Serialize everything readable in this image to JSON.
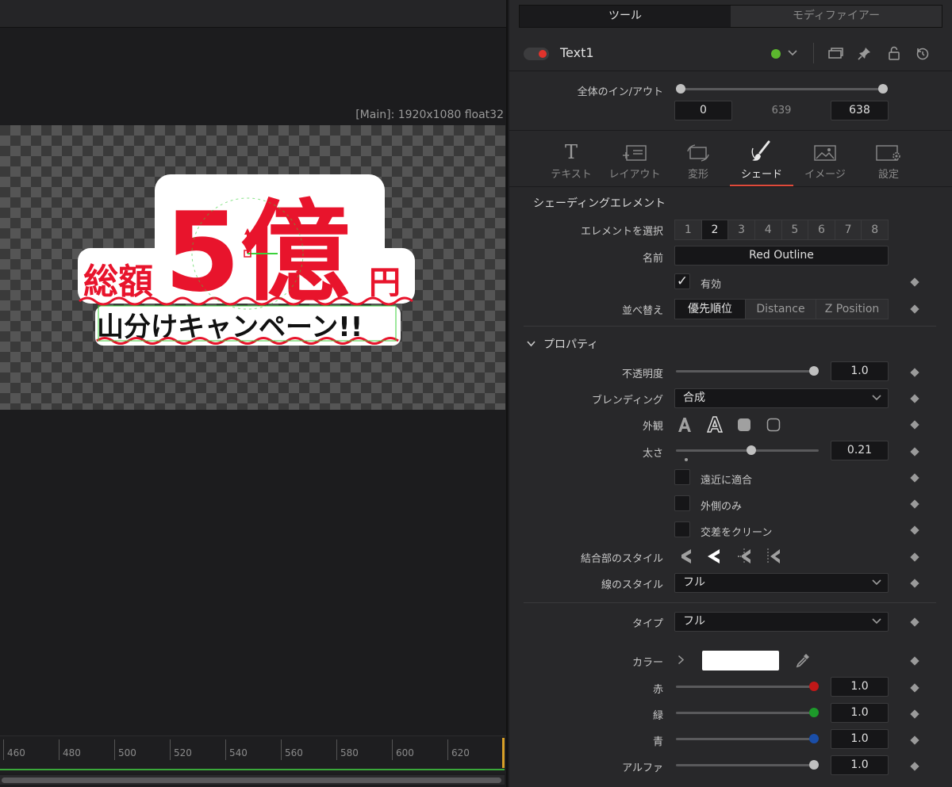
{
  "viewer": {
    "resolution_label": "[Main]: 1920x1080 float32",
    "timeline_ticks": [
      "460",
      "480",
      "500",
      "520",
      "540",
      "560",
      "580",
      "600",
      "620"
    ],
    "title_art": {
      "big_text": "5億",
      "left_text": "総額",
      "right_text": "円",
      "bottom_text": "山分けキャンペーン!!"
    }
  },
  "inspector": {
    "tabs": [
      {
        "label": "ツール",
        "active": true
      },
      {
        "label": "モディファイアー",
        "active": false
      }
    ],
    "node": {
      "name": "Text1",
      "color": "#5cb82e"
    },
    "global_inout": {
      "label": "全体のイン/アウト",
      "in": "0",
      "mid": "639",
      "out": "638"
    },
    "subtabs": [
      {
        "label": "テキスト",
        "icon": "text-t-icon"
      },
      {
        "label": "レイアウト",
        "icon": "layout-icon"
      },
      {
        "label": "変形",
        "icon": "transform-icon"
      },
      {
        "label": "シェード",
        "icon": "brush-icon",
        "active": true
      },
      {
        "label": "イメージ",
        "icon": "image-icon"
      },
      {
        "label": "設定",
        "icon": "settings-icon"
      }
    ],
    "shading": {
      "section_title": "シェーディングエレメント",
      "select_label": "エレメントを選択",
      "elements": [
        "1",
        "2",
        "3",
        "4",
        "5",
        "6",
        "7",
        "8"
      ],
      "active_element": "2",
      "name_label": "名前",
      "name_value": "Red Outline",
      "enabled_label": "有効",
      "enabled": true,
      "sort_label": "並べ替え",
      "sort_options": [
        "優先順位",
        "Distance",
        "Z Position"
      ],
      "sort_active": "優先順位"
    },
    "properties": {
      "header": "プロパティ",
      "opacity_label": "不透明度",
      "opacity": "1.0",
      "blending_label": "ブレンディング",
      "blending": "合成",
      "appearance_label": "外観",
      "thickness_label": "太さ",
      "thickness": "0.21",
      "adapt_label": "遠近に適合",
      "outside_label": "外側のみ",
      "clean_label": "交差をクリーン",
      "join_label": "結合部のスタイル",
      "line_style_label": "線のスタイル",
      "line_style": "フル"
    },
    "fill": {
      "type_label": "タイプ",
      "type": "フル",
      "color_label": "カラー",
      "swatch_color": "#ffffff",
      "red_label": "赤",
      "red": "1.0",
      "green_label": "緑",
      "green": "1.0",
      "blue_label": "青",
      "blue": "1.0",
      "alpha_label": "アルファ",
      "alpha": "1.0"
    }
  }
}
